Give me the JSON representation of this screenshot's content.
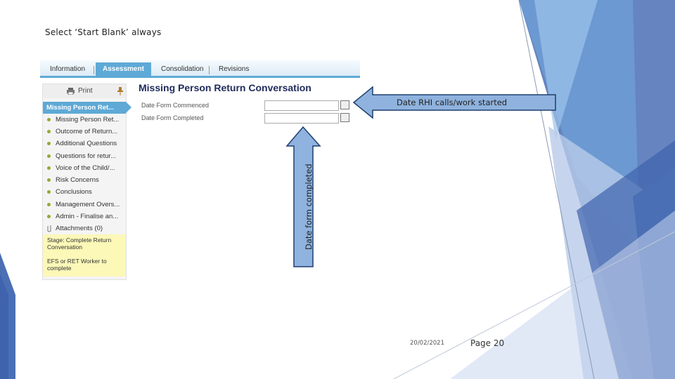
{
  "slide": {
    "title": "Select ‘Start Blank’ always",
    "date": "20/02/2021",
    "page": "Page 20"
  },
  "tabs": [
    {
      "label": "Information",
      "active": false
    },
    {
      "label": "Assessment",
      "active": true
    },
    {
      "label": "Consolidation",
      "active": false
    },
    {
      "label": "Revisions",
      "active": false
    }
  ],
  "sidebar": {
    "print_label": "Print",
    "header": "Missing Person Ret...",
    "items": [
      {
        "label": "Missing Person Ret..."
      },
      {
        "label": "Outcome of Return..."
      },
      {
        "label": "Additional Questions"
      },
      {
        "label": "Questions for retur..."
      },
      {
        "label": "Voice of the Child/..."
      },
      {
        "label": "Risk Concerns"
      },
      {
        "label": "Conclusions"
      },
      {
        "label": "Management Overs..."
      },
      {
        "label": "Admin - Finalise an..."
      }
    ],
    "attachments": "Attachments (0)",
    "stage_text": "Stage: Complete Return Conversation",
    "worker_text": "EFS or RET Worker to complete"
  },
  "form": {
    "title": "Missing Person Return Conversation",
    "fields": [
      {
        "label": "Date Form Commenced",
        "value": ""
      },
      {
        "label": "Date Form Completed",
        "value": ""
      }
    ]
  },
  "callouts": {
    "started": "Date RHI calls/work started",
    "completed": "Date form completed"
  },
  "colors": {
    "accent_blue": "#5ea9d6",
    "callout_fill": "#8fb3de",
    "deco_dark": "#4a6fb5",
    "deco_light": "#6fa0d8",
    "stage_yellow": "#fbf8b8"
  }
}
